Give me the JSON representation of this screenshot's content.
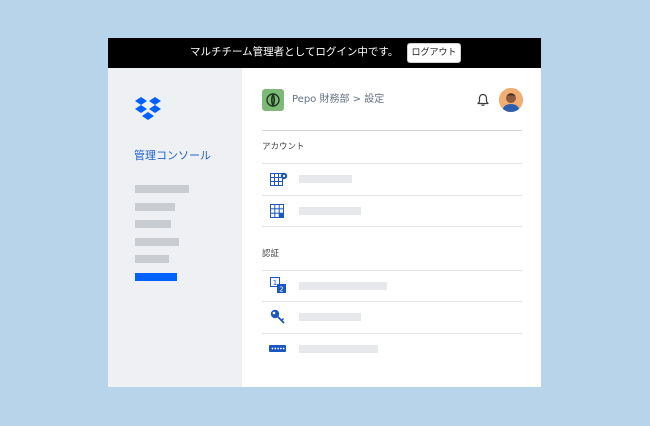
{
  "banner": {
    "message": "マルチチーム管理者としてログイン中です。",
    "logout_label": "ログアウト"
  },
  "sidebar": {
    "logo": "dropbox-logo",
    "title": "管理コンソール",
    "active_item": 6
  },
  "header": {
    "team_icon": "team-icon",
    "breadcrumb": "Pepo 財務部 > 設定",
    "notification_icon": "bell-icon",
    "avatar": "user-avatar"
  },
  "sections": [
    {
      "label": "アカウント",
      "rows": [
        {
          "icon": "grid-gear-icon"
        },
        {
          "icon": "grid-x-icon"
        }
      ]
    },
    {
      "label": "認証",
      "rows": [
        {
          "icon": "two-step-icon"
        },
        {
          "icon": "key-icon"
        },
        {
          "icon": "password-icon"
        }
      ]
    }
  ],
  "colors": {
    "accent": "#0061fe",
    "console_title": "#1f62c9",
    "banner": "#000000",
    "background": "#b8d4ea",
    "sidebar": "#eef0f4",
    "icon_blue": "#1a57c4"
  }
}
